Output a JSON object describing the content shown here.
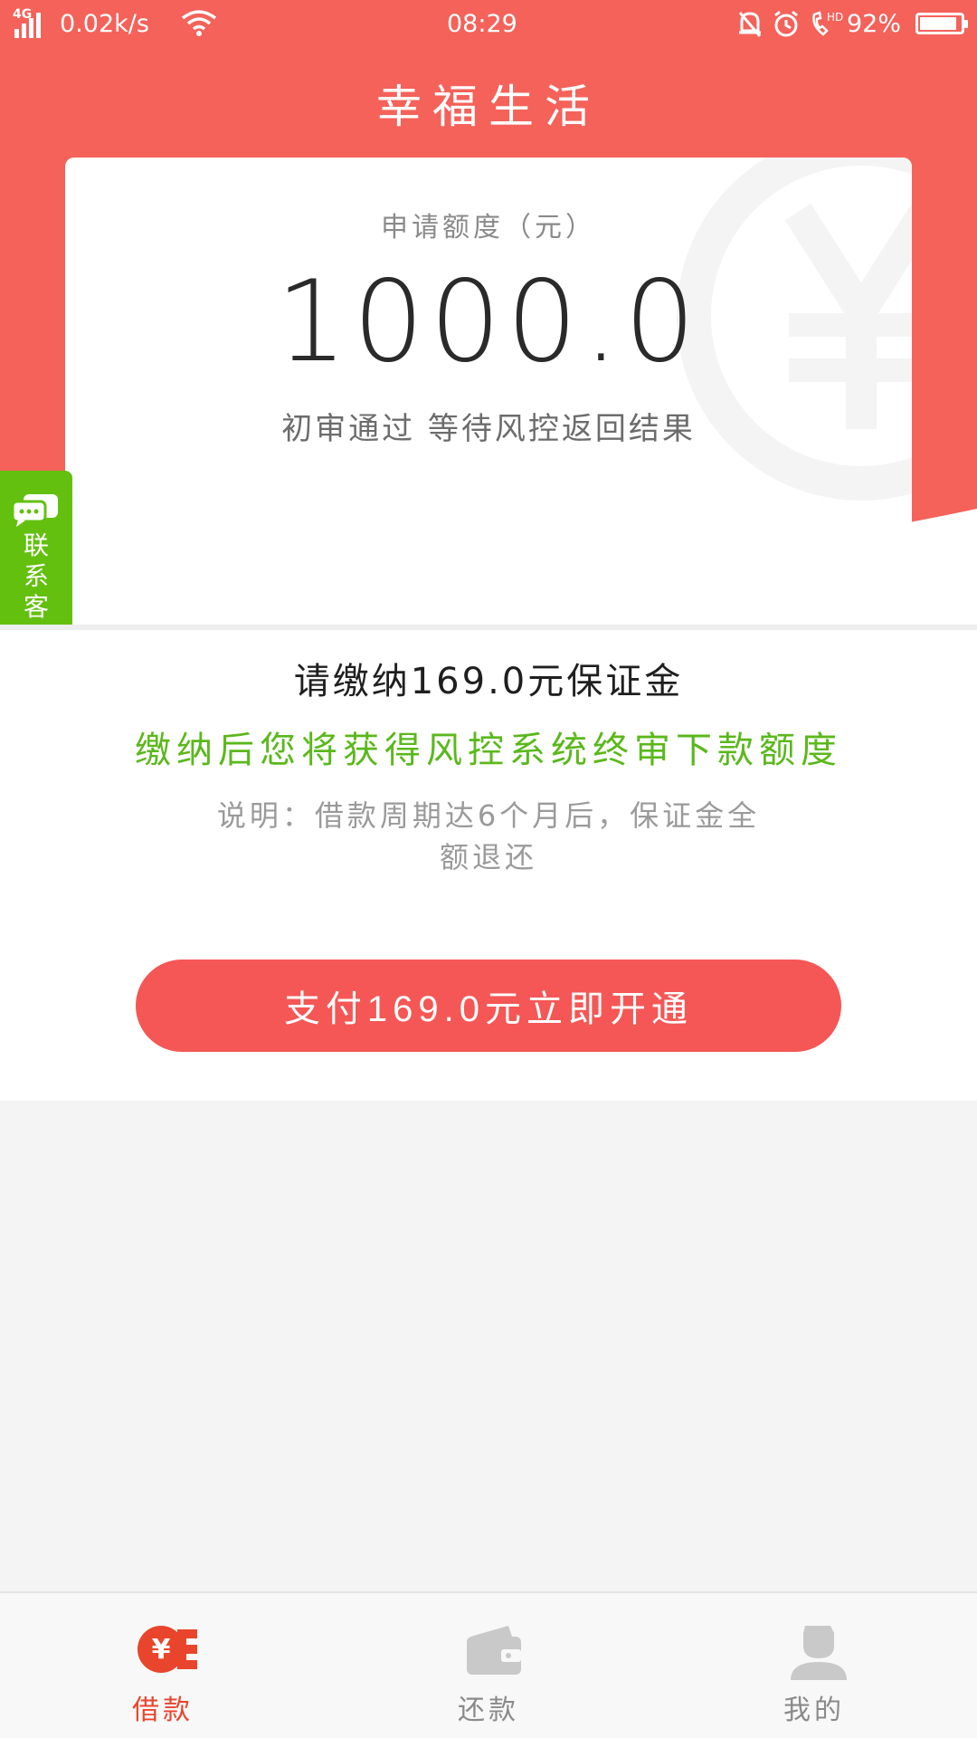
{
  "status_bar": {
    "network_type": "4G",
    "speed": "0.02k/s",
    "time": "08:29",
    "hd_label": "HD",
    "battery_text": "92%",
    "battery_level": 0.92
  },
  "app": {
    "title": "幸福生活"
  },
  "card": {
    "amount_label": "申请额度（元）",
    "amount_value": "1000.0",
    "review_status": "初审通过 等待风控返回结果"
  },
  "contact": {
    "label": "联系客服"
  },
  "deposit": {
    "title": "请缴纳169.0元保证金",
    "benefit": "缴纳后您将获得风控系统终审下款额度",
    "note": "说明：借款周期达6个月后，保证金全额退还",
    "pay_button": "支付169.0元立即开通"
  },
  "tabbar": {
    "items": [
      {
        "label": "借款",
        "icon": "yuan-loan-icon",
        "active": true
      },
      {
        "label": "还款",
        "icon": "wallet-icon",
        "active": false
      },
      {
        "label": "我的",
        "icon": "user-icon",
        "active": false
      }
    ]
  },
  "colors": {
    "brand": "#f4625a",
    "button": "#f45755",
    "accent_green": "#5bb81c",
    "contact_green": "#63c00f",
    "tab_active": "#e8452c",
    "tab_inactive": "#8a8a8a"
  }
}
